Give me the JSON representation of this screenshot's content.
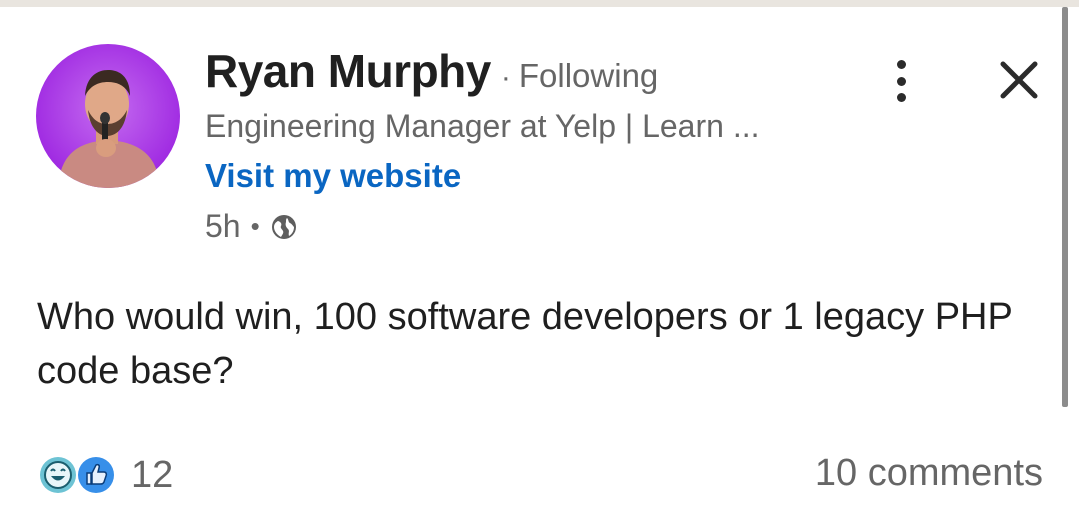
{
  "post": {
    "author": {
      "name": "Ryan Murphy",
      "follow_status": "Following",
      "separator": "·",
      "headline": "Engineering Manager at Yelp | Learn ...",
      "website_link": "Visit my website"
    },
    "meta": {
      "time": "5h",
      "separator": "•",
      "visibility_icon": "globe-icon"
    },
    "body": "Who would win, 100 software developers or 1 legacy PHP code base?",
    "social": {
      "reaction_icons": [
        "celebrate-icon",
        "like-icon"
      ],
      "reaction_count": "12",
      "comments": "10 comments"
    }
  },
  "actions": {
    "more_icon": "more-vertical-icon",
    "close_icon": "close-icon"
  },
  "colors": {
    "link": "#0a66c2",
    "secondary_text": "#666666",
    "avatar_ring": "#a530e6",
    "like_blue": "#378fe9",
    "celebrate_teal": "#6dc3d4"
  }
}
